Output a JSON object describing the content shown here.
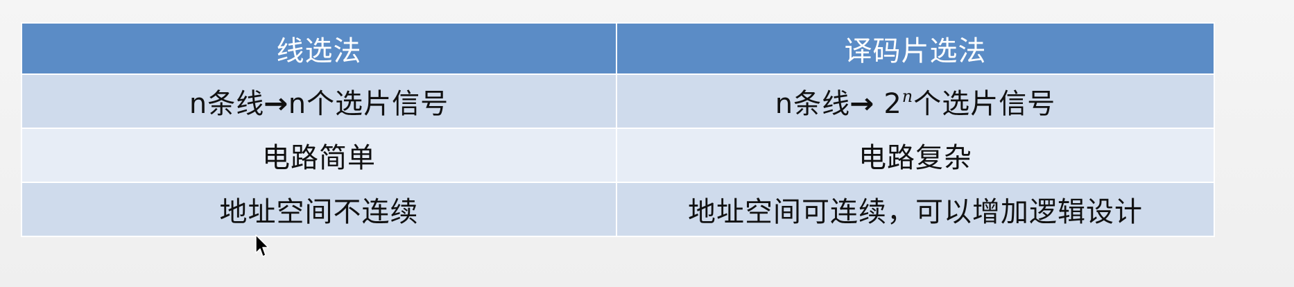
{
  "table": {
    "headers": [
      "线选法",
      "译码片选法"
    ],
    "rows": [
      {
        "left": {
          "prefix": "n条线",
          "arrow": "→",
          "suffix": "n个选片信号"
        },
        "right": {
          "prefix": "n条线",
          "arrow": "→",
          "base": " 2",
          "exponent": "n",
          "suffix": "个选片信号"
        }
      },
      {
        "left": {
          "text": "电路简单"
        },
        "right": {
          "text": "电路复杂"
        }
      },
      {
        "left": {
          "text": "地址空间不连续"
        },
        "right": {
          "text": "地址空间可连续，可以增加逻辑设计"
        }
      }
    ]
  },
  "colors": {
    "header_bg": "#5b8cc6",
    "row_odd_bg": "#cfdbec",
    "row_even_bg": "#e7edf6",
    "header_text": "#ffffff",
    "body_text": "#111111"
  },
  "cursor": {
    "icon": "mouse-pointer-icon"
  }
}
